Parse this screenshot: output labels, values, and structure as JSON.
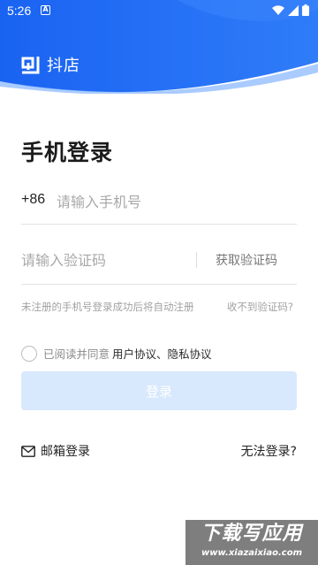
{
  "status_bar": {
    "time": "5:26",
    "notification_icon_letter": "A",
    "icons": [
      "wifi-icon",
      "signal-icon",
      "battery-icon"
    ]
  },
  "brand": {
    "name": "抖店",
    "logo_icon": "doudian-logo-icon"
  },
  "page": {
    "title": "手机登录"
  },
  "phone": {
    "country_code": "+86",
    "placeholder": "请输入手机号",
    "value": ""
  },
  "verification": {
    "placeholder": "请输入验证码",
    "value": "",
    "get_code_label": "获取验证码"
  },
  "hint": {
    "auto_register": "未注册的手机号登录成功后将自动注册",
    "no_code": "收不到验证码?"
  },
  "agreement": {
    "prefix": "已阅读并同意",
    "links": "用户协议、隐私协议",
    "checked": false
  },
  "login_button": {
    "label": "登录",
    "color": "#d8e8fd"
  },
  "footer": {
    "email_login": "邮箱登录",
    "cant_login": "无法登录?"
  },
  "watermark": {
    "main": "下载写应用",
    "sub": "www.xiazaixiao.com"
  },
  "colors": {
    "header_blue": "#1f6ff5",
    "header_light": "#4a92fb"
  }
}
